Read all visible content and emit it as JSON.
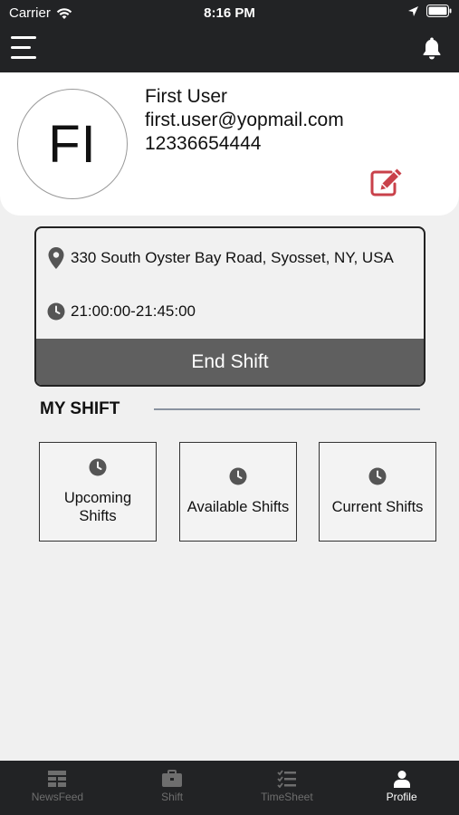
{
  "status_bar": {
    "carrier": "Carrier",
    "time": "8:16 PM"
  },
  "profile": {
    "initials": "FI",
    "name": "First User",
    "email": "first.user@yopmail.com",
    "phone": "12336654444"
  },
  "current_shift": {
    "address": "330 South Oyster Bay Road, Syosset, NY, USA",
    "time_range": "21:00:00-21:45:00",
    "end_label": "End Shift"
  },
  "my_shift": {
    "title": "MY SHIFT",
    "tiles": [
      {
        "label": "Upcoming Shifts",
        "icon": "clock-icon"
      },
      {
        "label": "Available Shifts",
        "icon": "clock-icon"
      },
      {
        "label": "Current Shifts",
        "icon": "clock-icon"
      }
    ]
  },
  "tabs": [
    {
      "label": "NewsFeed",
      "icon": "newsfeed-icon"
    },
    {
      "label": "Shift",
      "icon": "briefcase-icon"
    },
    {
      "label": "TimeSheet",
      "icon": "checklist-icon"
    },
    {
      "label": "Profile",
      "icon": "person-icon"
    }
  ],
  "active_tab": "Profile",
  "colors": {
    "header_bg": "#222325",
    "edit_accent": "#c9414a",
    "end_shift_bg": "#5f5f5f",
    "page_bg": "#f0f0f0"
  }
}
